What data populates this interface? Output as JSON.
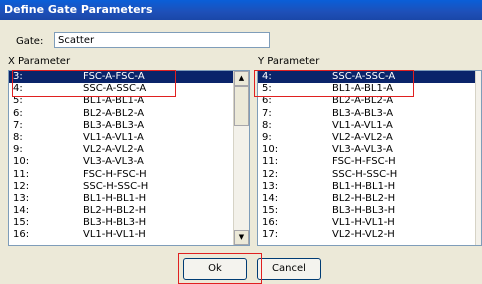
{
  "window": {
    "title": "Define Gate Parameters"
  },
  "gate": {
    "label": "Gate:",
    "value": "Scatter"
  },
  "x_param": {
    "label": "X Parameter",
    "items": [
      {
        "num": "3:",
        "name": "FSC-A-FSC-A"
      },
      {
        "num": "4:",
        "name": "SSC-A-SSC-A"
      },
      {
        "num": "5:",
        "name": "BL1-A-BL1-A"
      },
      {
        "num": "6:",
        "name": "BL2-A-BL2-A"
      },
      {
        "num": "7:",
        "name": "BL3-A-BL3-A"
      },
      {
        "num": "8:",
        "name": "VL1-A-VL1-A"
      },
      {
        "num": "9:",
        "name": "VL2-A-VL2-A"
      },
      {
        "num": "10:",
        "name": "VL3-A-VL3-A"
      },
      {
        "num": "11:",
        "name": "FSC-H-FSC-H"
      },
      {
        "num": "12:",
        "name": "SSC-H-SSC-H"
      },
      {
        "num": "13:",
        "name": "BL1-H-BL1-H"
      },
      {
        "num": "14:",
        "name": "BL2-H-BL2-H"
      },
      {
        "num": "15:",
        "name": "BL3-H-BL3-H"
      },
      {
        "num": "16:",
        "name": "VL1-H-VL1-H"
      }
    ]
  },
  "y_param": {
    "label": "Y Parameter",
    "items": [
      {
        "num": "4:",
        "name": "SSC-A-SSC-A"
      },
      {
        "num": "5:",
        "name": "BL1-A-BL1-A"
      },
      {
        "num": "6:",
        "name": "BL2-A-BL2-A"
      },
      {
        "num": "7:",
        "name": "BL3-A-BL3-A"
      },
      {
        "num": "8:",
        "name": "VL1-A-VL1-A"
      },
      {
        "num": "9:",
        "name": "VL2-A-VL2-A"
      },
      {
        "num": "10:",
        "name": "VL3-A-VL3-A"
      },
      {
        "num": "11:",
        "name": "FSC-H-FSC-H"
      },
      {
        "num": "12:",
        "name": "SSC-H-SSC-H"
      },
      {
        "num": "13:",
        "name": "BL1-H-BL1-H"
      },
      {
        "num": "14:",
        "name": "BL2-H-BL2-H"
      },
      {
        "num": "15:",
        "name": "BL3-H-BL3-H"
      },
      {
        "num": "16:",
        "name": "VL1-H-VL1-H"
      },
      {
        "num": "17:",
        "name": "VL2-H-VL2-H"
      }
    ]
  },
  "buttons": {
    "ok": "Ok",
    "cancel": "Cancel"
  }
}
